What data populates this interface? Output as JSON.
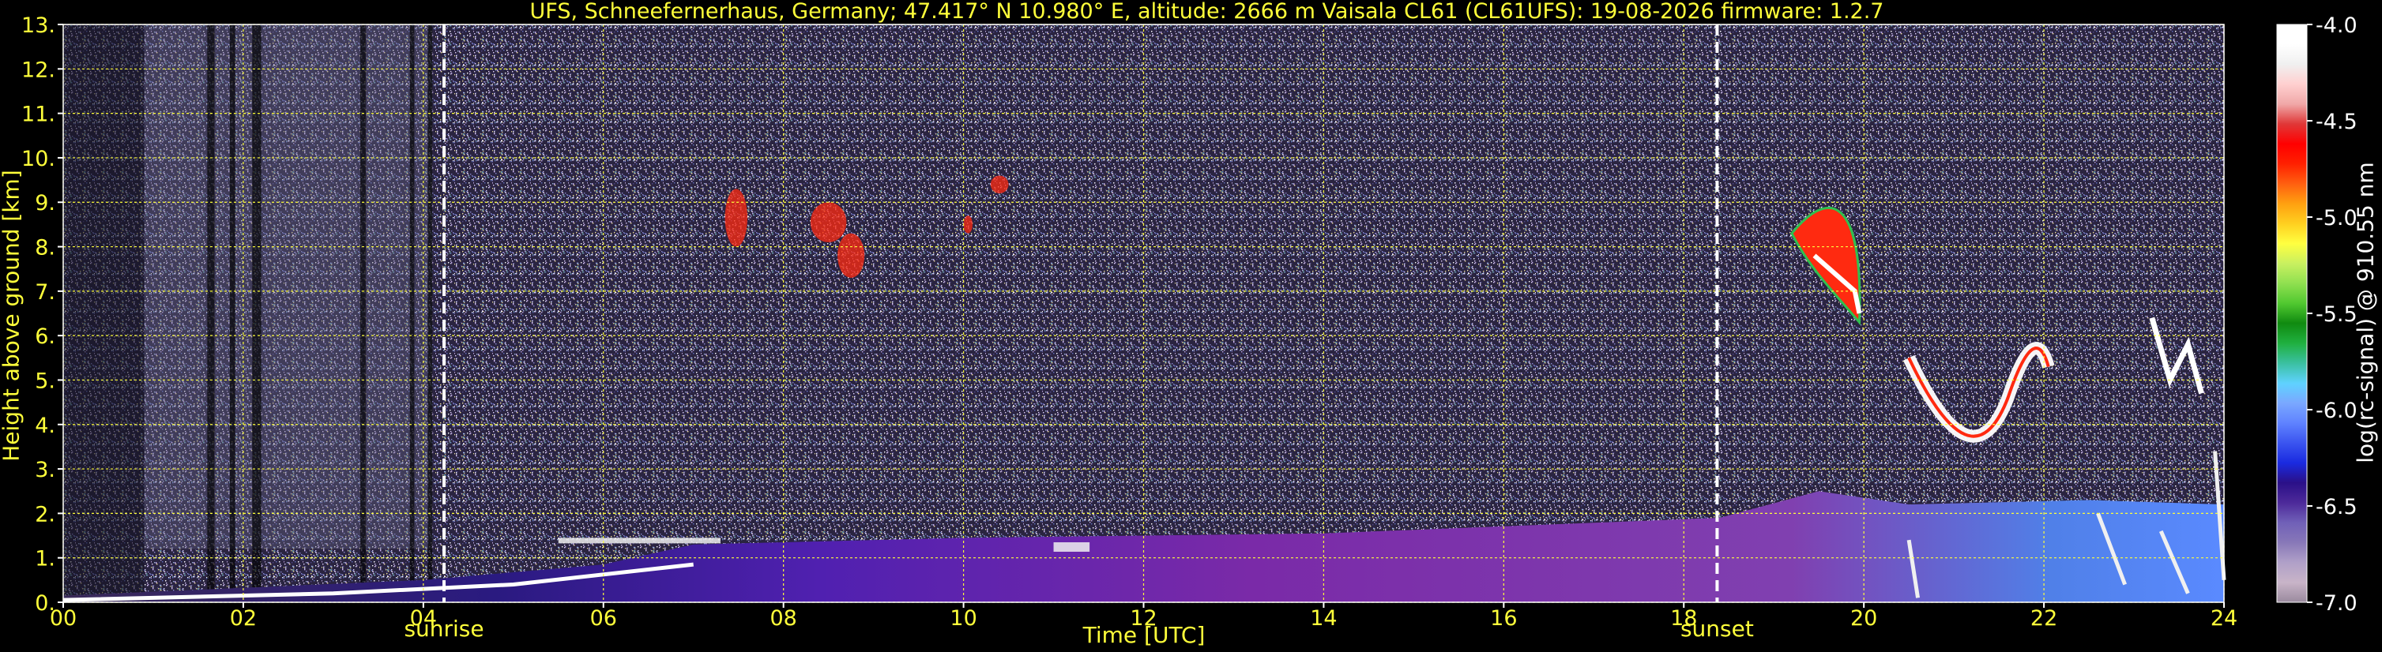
{
  "chart_data": {
    "type": "heatmap",
    "title": "UFS, Schneefernerhaus, Germany; 47.417° N 10.980° E, altitude: 2666 m    Vaisala CL61 (CL61UFS): 19-08-2026    firmware: 1.2.7",
    "xlabel": "Time [UTC]",
    "ylabel": "Height above ground [km]",
    "xlim": [
      0,
      24
    ],
    "ylim": [
      0,
      13
    ],
    "x_ticks": [
      0,
      2,
      4,
      6,
      8,
      10,
      12,
      14,
      16,
      18,
      20,
      22,
      24
    ],
    "x_tick_labels": [
      "00",
      "02",
      "04",
      "06",
      "08",
      "10",
      "12",
      "14",
      "16",
      "18",
      "20",
      "22",
      "24"
    ],
    "y_ticks": [
      0,
      1,
      2,
      3,
      4,
      5,
      6,
      7,
      8,
      9,
      10,
      11,
      12,
      13
    ],
    "y_tick_labels": [
      "0.",
      "1.",
      "2.",
      "3.",
      "4.",
      "5.",
      "6.",
      "7.",
      "8.",
      "9.",
      "10.",
      "11.",
      "12.",
      "13."
    ],
    "grid": true,
    "colorbar": {
      "label": "log(rc-signal) @ 910.55 nm",
      "range": [
        -7.0,
        -4.0
      ],
      "ticks": [
        -7.0,
        -6.5,
        -6.0,
        -5.5,
        -5.0,
        -4.5,
        -4.0
      ],
      "tick_labels": [
        "-7.0",
        "-6.5",
        "-6.0",
        "-5.5",
        "-5.0",
        "-4.5",
        "-4.0"
      ],
      "colors": [
        "#9a8a9e",
        "#c8b4c8",
        "#b0a0c8",
        "#8878b8",
        "#7060b8",
        "#4d2a9a",
        "#2a1088",
        "#1a2ae0",
        "#3b55f0",
        "#5f82ff",
        "#7aa8ff",
        "#5fd2ff",
        "#3ac0a0",
        "#20b040",
        "#108a10",
        "#50c830",
        "#90e050",
        "#c8f060",
        "#ffff40",
        "#ffd020",
        "#ffa010",
        "#ff6010",
        "#ff2000",
        "#ff0000",
        "#e03838",
        "#f0a8a8",
        "#ffd0d0",
        "#f0f0f0",
        "#ffffff",
        "#ffffff"
      ]
    },
    "annotations": [
      {
        "label": "sunrise",
        "x": 4.23
      },
      {
        "label": "sunset",
        "x": 18.37
      }
    ]
  },
  "colors": {
    "text": "#ffff3a",
    "grid": "#ffff3a",
    "sun_line": "#ffffff",
    "background": "#000000",
    "sky": "#2a2440"
  }
}
